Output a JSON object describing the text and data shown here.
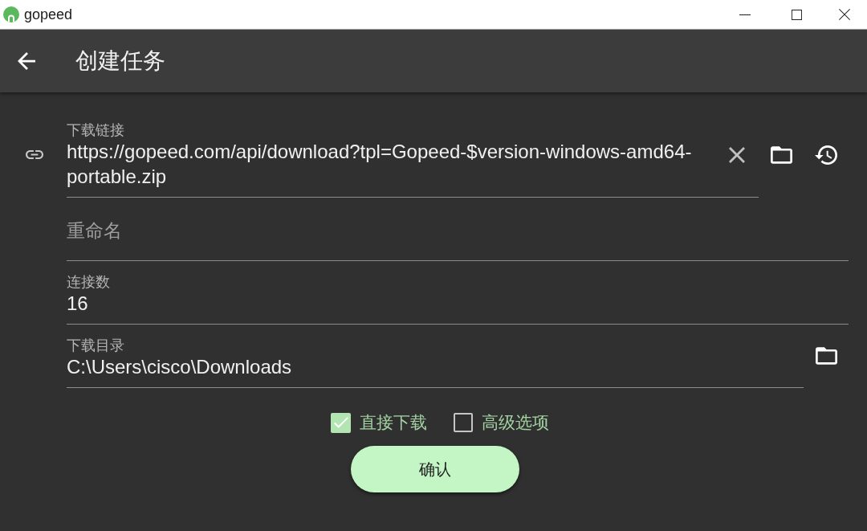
{
  "window": {
    "title": "gopeed"
  },
  "app_bar": {
    "title": "创建任务"
  },
  "form": {
    "fields": [
      {
        "kind": "url",
        "label": "下载链接",
        "value": "https://gopeed.com/api/download?tpl=Gopeed-$version-windows-amd64-portable.zip"
      },
      {
        "kind": "text",
        "placeholder": "重命名"
      },
      {
        "kind": "text",
        "label": "连接数",
        "value": "16"
      },
      {
        "kind": "directory",
        "label": "下载目录",
        "value": "C:\\Users\\cisco\\Downloads"
      }
    ],
    "options": [
      {
        "label": "直接下载",
        "checked": true
      },
      {
        "label": "高级选项",
        "checked": false
      }
    ],
    "submit": "确认"
  }
}
